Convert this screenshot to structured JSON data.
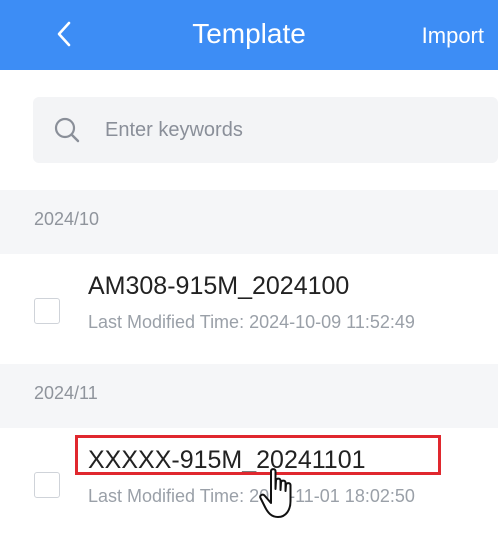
{
  "header": {
    "title": "Template",
    "import_label": "Import",
    "background": "#3d8df5"
  },
  "search": {
    "placeholder": "Enter keywords"
  },
  "groups": [
    {
      "label": "2024/10",
      "items": [
        {
          "name": "AM308-915M_2024100",
          "modified": "Last Modified Time: 2024-10-09 11:52:49",
          "checked": false
        }
      ]
    },
    {
      "label": "2024/11",
      "items": [
        {
          "name": "XXXXX-915M_20241101",
          "modified": "Last Modified Time: 2024-11-01 18:02:50",
          "checked": false,
          "highlighted": true
        }
      ]
    }
  ],
  "highlight_color": "#e0282e"
}
